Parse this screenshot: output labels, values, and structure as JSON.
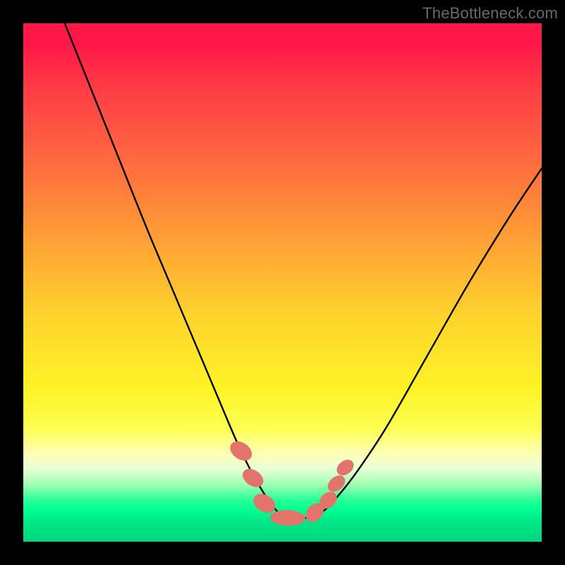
{
  "watermark": "TheBottleneck.com",
  "chart_data": {
    "type": "line",
    "title": "",
    "xlabel": "",
    "ylabel": "",
    "xlim": [
      0,
      100
    ],
    "ylim": [
      0,
      100
    ],
    "grid": false,
    "series": [
      {
        "name": "bottleneck-curve",
        "x": [
          8,
          12,
          16,
          20,
          24,
          28,
          32,
          36,
          40,
          42,
          44,
          46,
          48,
          50,
          52,
          54,
          56,
          58,
          60,
          64,
          70,
          78,
          86,
          94,
          100
        ],
        "values": [
          100,
          90,
          80,
          70,
          60,
          50.5,
          41,
          31.5,
          22,
          17.5,
          13.5,
          10,
          7,
          5,
          4.5,
          4.5,
          5,
          6,
          8,
          13,
          22,
          36,
          50,
          63,
          72
        ]
      }
    ],
    "markers": [
      {
        "name": "pill-a",
        "cx": 42.0,
        "cy": 17.5,
        "rx": 1.6,
        "ry": 2.3,
        "rot": -55
      },
      {
        "name": "pill-b",
        "cx": 44.3,
        "cy": 12.3,
        "rx": 1.5,
        "ry": 2.2,
        "rot": -55
      },
      {
        "name": "pill-c",
        "cx": 46.5,
        "cy": 7.4,
        "rx": 1.6,
        "ry": 2.3,
        "rot": -58
      },
      {
        "name": "pill-d",
        "cx": 51.0,
        "cy": 4.6,
        "rx": 3.4,
        "ry": 1.5,
        "rot": 2
      },
      {
        "name": "pill-e",
        "cx": 56.2,
        "cy": 5.6,
        "rx": 1.5,
        "ry": 2.0,
        "rot": 40
      },
      {
        "name": "pill-f",
        "cx": 58.8,
        "cy": 8.0,
        "rx": 1.4,
        "ry": 1.9,
        "rot": 48
      },
      {
        "name": "pill-g",
        "cx": 60.4,
        "cy": 11.2,
        "rx": 1.3,
        "ry": 1.9,
        "rot": 50
      },
      {
        "name": "pill-h",
        "cx": 62.1,
        "cy": 14.3,
        "rx": 1.3,
        "ry": 1.8,
        "rot": 52
      }
    ],
    "marker_color": "#e2746c"
  }
}
